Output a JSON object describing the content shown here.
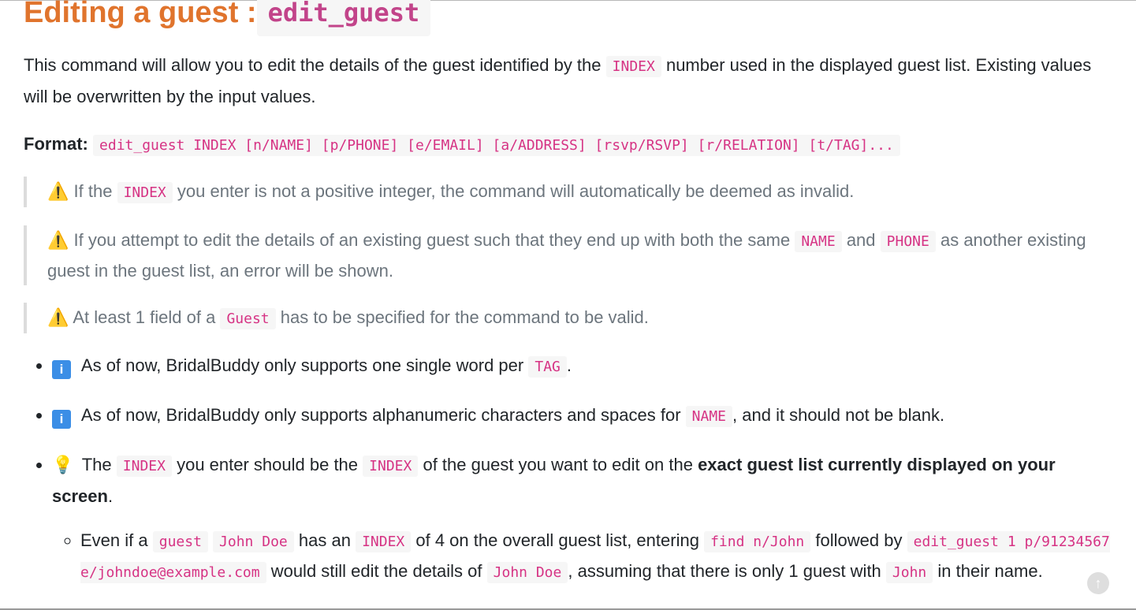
{
  "heading": {
    "text": "Editing a guest :",
    "code": "edit_guest"
  },
  "intro": {
    "part1": "This command will allow you to edit the details of the guest identified by the",
    "code1": "INDEX",
    "part2": "number used in the displayed guest list. Existing values will be overwritten by the input values."
  },
  "format": {
    "label": "Format:",
    "code": "edit_guest INDEX [n/NAME] [p/PHONE] [e/EMAIL] [a/ADDRESS] [rsvp/RSVP] [r/RELATION] [t/TAG]..."
  },
  "warnings": [
    {
      "icon": "⚠️",
      "t1": "If the",
      "c1": "INDEX",
      "t2": "you enter is not a positive integer, the command will automatically be deemed as invalid."
    },
    {
      "icon": "⚠️",
      "t1": "If you attempt to edit the details of an existing guest such that they end up with both the same",
      "c1": "NAME",
      "t2": "and",
      "c2": "PHONE",
      "t3": "as another existing guest in the guest list, an error will be shown."
    },
    {
      "icon": "⚠️",
      "t1": "At least 1 field of a",
      "c1": "Guest",
      "t2": "has to be specified for the command to be valid."
    }
  ],
  "notes": [
    {
      "icon": "i",
      "t1": "As of now, BridalBuddy only supports one single word per",
      "c1": "TAG",
      "t2": "."
    },
    {
      "icon": "i",
      "t1": "As of now, BridalBuddy only supports alphanumeric characters and spaces for",
      "c1": "NAME",
      "t2": ", and it should not be blank."
    },
    {
      "icon": "💡",
      "t1": "The",
      "c1": "INDEX",
      "t2": "you enter should be the",
      "c2": "INDEX",
      "t3": "of the guest you want to edit on the",
      "bold": "exact guest list currently displayed on your screen",
      "t4": "."
    }
  ],
  "sub": {
    "t1": "Even if a",
    "c1": "guest",
    "c2": "John Doe",
    "t2": "has an",
    "c3": "INDEX",
    "t3": "of 4 on the overall guest list, entering",
    "c4": "find n/John",
    "t4": "followed by",
    "c5": "edit_guest 1 p/91234567 e/johndoe@example.com",
    "t5": "would still edit the details of",
    "c6": "John Doe",
    "t6": ", assuming that there is only 1 guest with",
    "c7": "John",
    "t7": "in their name."
  }
}
